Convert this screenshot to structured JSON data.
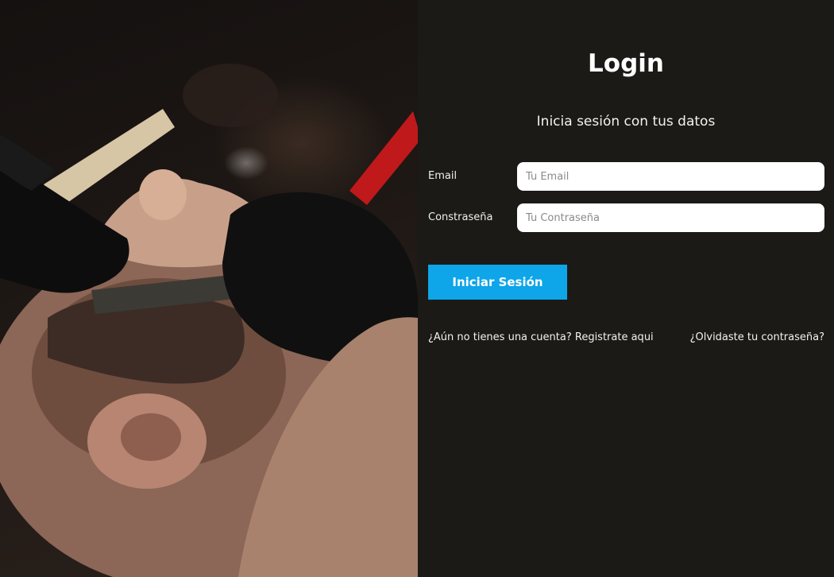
{
  "hero": {
    "image": "barber-shaving-beard-photo"
  },
  "login": {
    "title": "Login",
    "subtitle": "Inicia sesión con tus datos",
    "email": {
      "label": "Email",
      "placeholder": "Tu Email",
      "value": ""
    },
    "password": {
      "label": "Constraseña",
      "placeholder": "Tu Contraseña",
      "value": ""
    },
    "submit_label": "Iniciar Sesión",
    "register_link": "¿Aún no tienes una cuenta? Registrate aqui",
    "forgot_link": "¿Olvidaste tu contraseña?"
  },
  "colors": {
    "panel_background": "#1b1a17",
    "accent": "#0ea5e9",
    "text": "#ffffff",
    "input_background": "#ffffff"
  }
}
